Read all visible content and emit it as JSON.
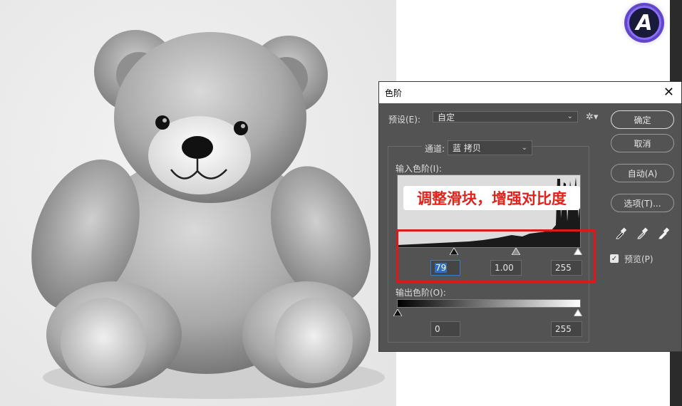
{
  "dialog": {
    "title": "色阶",
    "close_label": "✕",
    "preset_label": "预设(E):",
    "preset_value": "自定",
    "channel_label": "通道:",
    "channel_value": "蓝 拷贝",
    "input_levels_label": "输入色阶(I):",
    "output_levels_label": "输出色阶(O):",
    "input_black": "79",
    "input_gamma": "1.00",
    "input_white": "255",
    "output_black": "0",
    "output_white": "255",
    "buttons": {
      "ok": "确定",
      "cancel": "取消",
      "auto": "自动(A)",
      "options": "选项(T)..."
    },
    "preview_label": "预览(P)",
    "preview_checked": true
  },
  "annotation": {
    "text": "调整滑块，增强对比度",
    "color": "#e0241b",
    "box_color": "#e3161a"
  },
  "logo": {
    "letter": "A"
  },
  "icons": {
    "gear": "gear-icon",
    "black_eyedropper": "black-eyedropper-icon",
    "gray_eyedropper": "gray-eyedropper-icon",
    "white_eyedropper": "white-eyedropper-icon"
  },
  "colors": {
    "dialog_bg": "#535353",
    "accent_field_border": "#2f7fd1"
  }
}
